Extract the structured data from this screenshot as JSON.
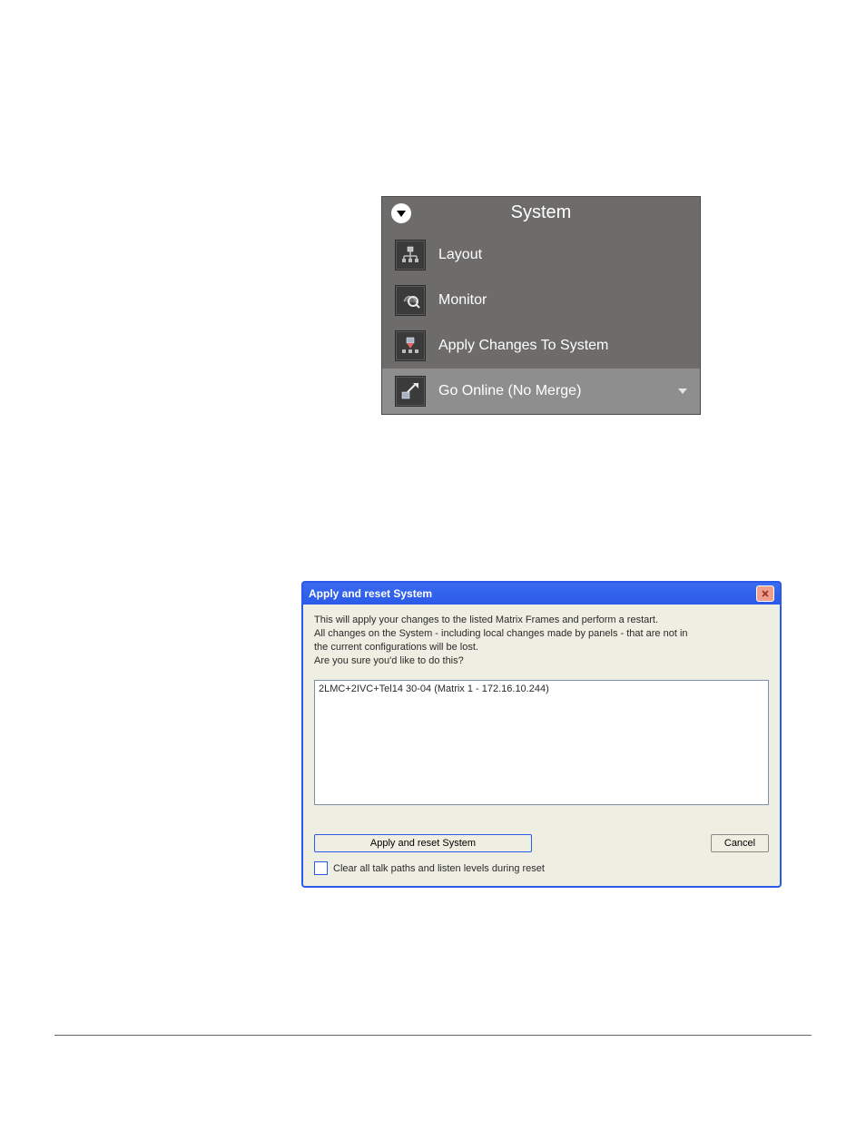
{
  "system_menu": {
    "title": "System",
    "items": [
      {
        "label": "Layout",
        "icon": "layout-icon"
      },
      {
        "label": "Monitor",
        "icon": "monitor-icon"
      },
      {
        "label": "Apply Changes To System",
        "icon": "apply-icon"
      },
      {
        "label": "Go Online (No Merge)",
        "icon": "go-online-icon",
        "selected": true,
        "has_dropdown": true
      }
    ]
  },
  "dialog": {
    "title": "Apply and reset System",
    "message_line1": "This will apply your changes to the listed Matrix Frames and perform a restart.",
    "message_line2": "All changes on the System - including local changes made by panels - that are not in",
    "message_line3": "the current configurations will be lost.",
    "message_line4": "Are you sure you'd like to do this?",
    "list_items": [
      "2LMC+2IVC+Tel14 30-04 (Matrix 1 - 172.16.10.244)"
    ],
    "apply_button": "Apply and reset System",
    "cancel_button": "Cancel",
    "checkbox_label": "Clear all talk paths and listen levels during reset"
  }
}
